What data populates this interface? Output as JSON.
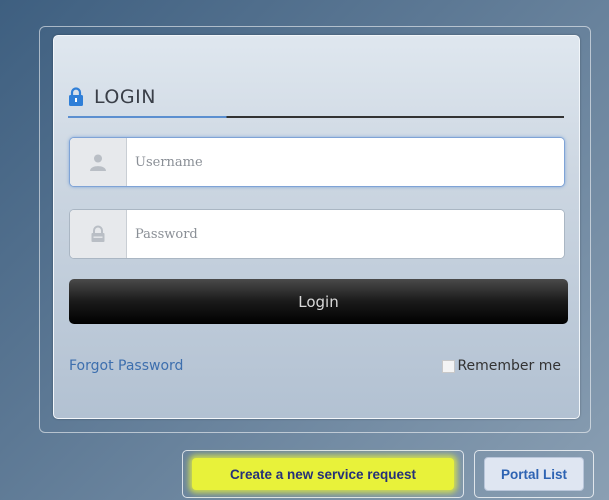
{
  "header": {
    "login_title": "LOGIN"
  },
  "form": {
    "username_placeholder": "Username",
    "password_placeholder": "Password",
    "login_button": "Login",
    "forgot_password": "Forgot Password",
    "remember_me": "Remember me"
  },
  "footer": {
    "create_request": "Create a new service request",
    "portal_list": "Portal List"
  },
  "colors": {
    "accent": "#5b8fd0",
    "link": "#3d6fae",
    "highlight": "#e8f23a"
  }
}
